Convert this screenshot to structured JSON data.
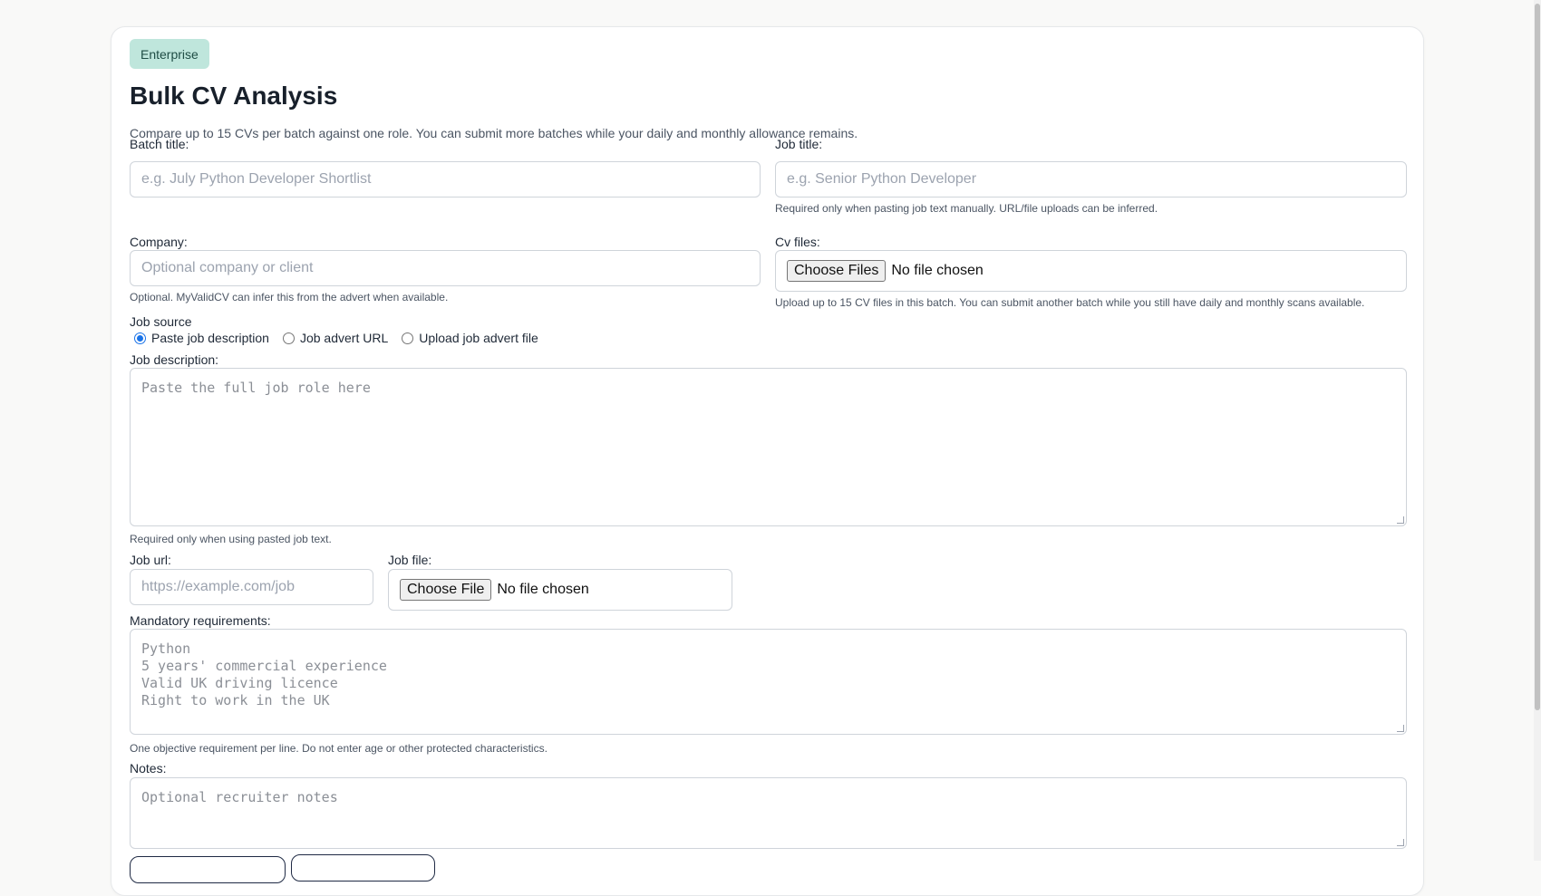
{
  "badge": "Enterprise",
  "page_title": "Bulk CV Analysis",
  "intro": "Compare up to 15 CVs per batch against one role. You can submit more batches while your daily and monthly allowance remains.",
  "batch_title": {
    "label": "Batch title:",
    "placeholder": "e.g. July Python Developer Shortlist"
  },
  "job_title": {
    "label": "Job title:",
    "placeholder": "e.g. Senior Python Developer",
    "hint": "Required only when pasting job text manually. URL/file uploads can be inferred."
  },
  "company": {
    "label": "Company:",
    "placeholder": "Optional company or client",
    "hint": "Optional. MyValidCV can infer this from the advert when available."
  },
  "cv_files": {
    "label": "Cv files:",
    "button": "Choose Files",
    "status": "No file chosen",
    "hint": "Upload up to 15 CV files in this batch. You can submit another batch while you still have daily and monthly scans available."
  },
  "job_source": {
    "label": "Job source",
    "options": [
      {
        "label": "Paste job description",
        "selected": true
      },
      {
        "label": "Job advert URL",
        "selected": false
      },
      {
        "label": "Upload job advert file",
        "selected": false
      }
    ]
  },
  "job_description": {
    "label": "Job description:",
    "placeholder": "Paste the full job role here",
    "hint": "Required only when using pasted job text."
  },
  "job_url": {
    "label": "Job url:",
    "placeholder": "https://example.com/job"
  },
  "job_file": {
    "label": "Job file:",
    "button": "Choose File",
    "status": "No file chosen"
  },
  "mandatory": {
    "label": "Mandatory requirements:",
    "placeholder_lines": [
      "Python",
      "5 years' commercial experience",
      "Valid UK driving licence",
      "Right to work in the UK"
    ],
    "hint": "One objective requirement per line. Do not enter age or other protected characteristics."
  },
  "notes": {
    "label": "Notes:",
    "placeholder": "Optional recruiter notes"
  },
  "colors": {
    "badge_bg": "#bfe6dc",
    "radio_accent": "#1a73e8",
    "button_border": "#1f2a44"
  }
}
